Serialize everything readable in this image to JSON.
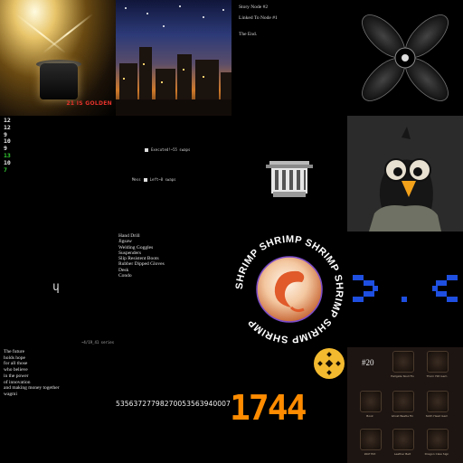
{
  "tiles": {
    "golden": {
      "title": "21 IS GOLDEN",
      "subtitle": ""
    },
    "city": {
      "caption": ""
    },
    "story": {
      "lines": [
        "Story Node #2",
        "Linked To Node #1",
        "The End."
      ]
    },
    "flower": {
      "icon": "four-petal-star-icon"
    },
    "numbers": {
      "values": [
        "12",
        "12",
        "9",
        "10",
        "9",
        "13",
        "10",
        "7"
      ],
      "colors": [
        "#e8e8e8",
        "#e8e8e8",
        "#e8e8e8",
        "#e8e8e8",
        "#e8e8e8",
        "#33cc33",
        "#e8e8e8",
        "#33cc33"
      ]
    },
    "exec": {
      "row1": "Executed!~55 swaps",
      "row2_label": "Mess",
      "row2": "Left~8 swaps"
    },
    "bucket": {
      "icon": "bucket-icon"
    },
    "bird": {
      "icon": "crow-character-icon"
    },
    "series": {
      "label": "~4/19_41 series"
    },
    "glyph": {
      "text": "ɥ"
    },
    "list": {
      "items": [
        "Hand Drill",
        "Jigsaw",
        "Welding Goggles",
        "Suspenders",
        "Slip Resistent Boots",
        "Rubber Dipped Gloves",
        "Desk",
        "Condo"
      ]
    },
    "shrimp": {
      "ring_text": "SHRIMP SHRIMP SHRIMP SHRIMP SHRIMP SHRIMP "
    },
    "face": {
      "text": ">.<",
      "color": "#1e4fe0"
    },
    "poem": {
      "lines": [
        "The future",
        "holds hope",
        "for all those",
        "who believe",
        "in the power",
        "of innovation",
        "and making money together",
        "wagmi"
      ]
    },
    "bignum": {
      "value": "53563727798270053563940007"
    },
    "pixnum": {
      "value": "1744",
      "color": "#ff8c00",
      "coin_color": "#f3ba2f"
    },
    "inventory": {
      "number": "#20",
      "slots": [
        {
          "label": "Hellgate Skull Fin"
        },
        {
          "label": "Thorn Hilt Gem"
        },
        {
          "label": "Book"
        },
        {
          "label": "Ghost Beetle Fin"
        },
        {
          "label": "Sloth Head Gem"
        },
        {
          "label": "Wolf Hilt"
        },
        {
          "label": "Leather Belt"
        },
        {
          "label": "Dragon Claw Sign"
        }
      ]
    }
  }
}
